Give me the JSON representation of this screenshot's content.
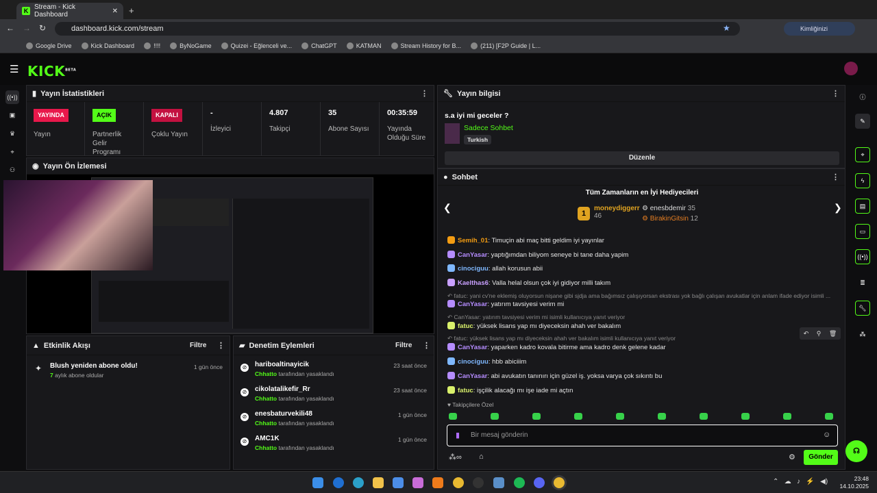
{
  "browser": {
    "tab_title": "Stream - Kick Dashboard",
    "url": "dashboard.kick.com/stream",
    "verify_label": "Kimliğinizi doğrulayın",
    "bookmarks": [
      "Google Drive",
      "Kick Dashboard",
      "!!!!",
      "ByNoGame",
      "Quizei - Eğlenceli ve...",
      "ChatGPT",
      "KATMAN",
      "Stream History for B...",
      "(211) [F2P Guide | L..."
    ]
  },
  "header": {
    "logo": "KICK",
    "beta": "BETA"
  },
  "stats": {
    "title": "Yayın İstatistikleri",
    "items": [
      {
        "badge": "YAYINDA",
        "label": "Yayın"
      },
      {
        "badge": "AÇIK",
        "label": "Partnerlik Gelir Programı"
      },
      {
        "badge": "KAPALI",
        "label": "Çoklu Yayın"
      },
      {
        "value": "-",
        "label": "İzleyici"
      },
      {
        "value": "4.807",
        "label": "Takipçi"
      },
      {
        "value": "35",
        "label": "Abone Sayısı"
      },
      {
        "value": "00:35:59",
        "label": "Yayında Olduğu Süre"
      }
    ]
  },
  "preview": {
    "title": "Yayın Ön İzlemesi"
  },
  "info": {
    "title": "Yayın bilgisi",
    "stream_title": "s.a iyi mi geceler ?",
    "category": "Sadece Sohbet",
    "language": "Turkish",
    "edit": "Düzenle"
  },
  "chat": {
    "title": "Sohbet",
    "gifters_title": "Tüm Zamanların en İyi Hediyecileri",
    "top": [
      {
        "rank": "1",
        "name": "moneydiggerr",
        "count": "46"
      },
      {
        "name": "enesbdemir",
        "count": "35"
      },
      {
        "name": "BirakinGitsin",
        "count": "12"
      }
    ],
    "messages": [
      {
        "name": "Semih_01",
        "text": "Timuçin abi maç bitti geldim iyi yayınlar",
        "color": "#f39c12"
      },
      {
        "name": "CanYasar",
        "text": "yaptığımdan biliyom seneye bi tane daha yapim",
        "color": "#b58cff"
      },
      {
        "name": "cinociguu",
        "text": "allah korusun abii",
        "color": "#7fb8ff"
      },
      {
        "name": "Kaelthas6",
        "text": "Valla helal olsun çok iyi gidiyor milli takım",
        "color": "#c9a0ff"
      },
      {
        "reply": "fatuc: yani cv'ne eklemiş oluyorsun nişane gibi sjdja ama bağımsız çalışıyorsan ekstrası yok bağlı çalışan avukatlar için anlam ifade ediyor isimli ..."
      },
      {
        "name": "CanYasar",
        "text": "yatırım tavsiyesi verim mi",
        "color": "#b58cff"
      },
      {
        "reply": "CanYasar: yatırım tavsiyesi verim mi isimli kullanıcıya yanıt veriyor"
      },
      {
        "name": "fatuc",
        "text": "yüksek lisans yap mı diyeceksin ahah ver bakalım",
        "color": "#d9f06b"
      },
      {
        "reply": "fatuc: yüksek lisans yap mı diyeceksin ahah ver bakalım isimli kullanıcıya yanıt veriyor"
      },
      {
        "name": "CanYasar",
        "text": "yaparken kadro kovala bitirme ama kadro denk gelene kadar",
        "color": "#b58cff"
      },
      {
        "name": "cinociguu",
        "text": "hbb abiciiim",
        "color": "#7fb8ff"
      },
      {
        "name": "CanYasar",
        "text": "abi avukatın tanınırı için güzel iş. yoksa varya çok sıkıntı bu",
        "color": "#b58cff"
      },
      {
        "name": "fatuc",
        "text": "işçilik alacağı mı işe iade mi açtın",
        "color": "#d9f06b"
      }
    ],
    "followers_only": "Takipçilere Özel",
    "placeholder": "Bir mesaj gönderin",
    "send": "Gönder"
  },
  "activity": {
    "title": "Etkinlik Akışı",
    "filter": "Filtre",
    "event": "Blush yeniden abone oldu!",
    "sub_count": "7",
    "sub_text": "aylık abone oldular",
    "time": "1 gün önce"
  },
  "mod": {
    "title": "Denetim Eylemleri",
    "filter": "Filtre",
    "items": [
      {
        "user": "hariboaltinayicik",
        "by": "Chhatto",
        "action": "tarafından yasaklandı",
        "time": "23 saat önce"
      },
      {
        "user": "cikolatalikefir_Rr",
        "by": "Chhatto",
        "action": "tarafından yasaklandı",
        "time": "23 saat önce"
      },
      {
        "user": "enesbaturvekili48",
        "by": "Chhatto",
        "action": "tarafından yasaklandı",
        "time": "1 gün önce"
      },
      {
        "user": "AMC1K",
        "by": "Chhatto",
        "action": "tarafından yasaklandı",
        "time": "1 gün önce"
      }
    ]
  },
  "clock": {
    "time": "23:48",
    "date": "14.10.2025"
  }
}
